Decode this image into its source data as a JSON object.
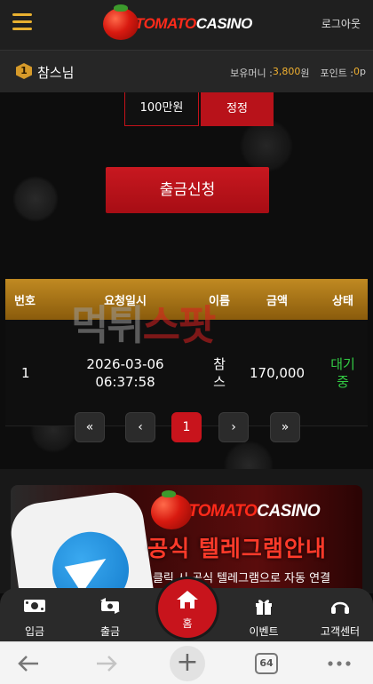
{
  "header": {
    "logo_tomato": "TOMATO",
    "logo_casino": "CASINO",
    "logout_label": "로그아웃"
  },
  "user": {
    "level": "1",
    "name": "참스님",
    "balance_label": "보유머니 : ",
    "balance_value": "3,800",
    "balance_unit": "원",
    "point_label": "포인트 : ",
    "point_value": "0",
    "point_unit": "p"
  },
  "amount_buttons": {
    "million_label": "100만원",
    "fix_label": "정정"
  },
  "withdraw_button_label": "출금신청",
  "table": {
    "headers": [
      "번호",
      "요청일시",
      "이름",
      "금액",
      "상태"
    ],
    "rows": [
      {
        "no": "1",
        "date": "2026-03-06",
        "time": "06:37:58",
        "name_1": "참",
        "name_2": "스",
        "amount": "170,000",
        "status_1": "대기",
        "status_2": "중"
      }
    ]
  },
  "watermark": {
    "part1": "먹튀",
    "part2": "스팟"
  },
  "pagination": {
    "first": "«",
    "prev": "‹",
    "current": "1",
    "next": "›",
    "last": "»"
  },
  "banner": {
    "logo_tomato": "TOMATO",
    "logo_casino": "CASINO",
    "title": "공식 텔레그램안내",
    "subtitle": "클릭 시 공식 텔레그램으로 자동 연결"
  },
  "bottom_nav": {
    "deposit": "입금",
    "withdraw": "출금",
    "home": "홈",
    "event": "이벤트",
    "support": "고객센터"
  },
  "browser": {
    "tab_count": "64"
  },
  "colors": {
    "accent_red": "#c8141c",
    "gold": "#f0b030",
    "status_green": "#33cc44"
  }
}
